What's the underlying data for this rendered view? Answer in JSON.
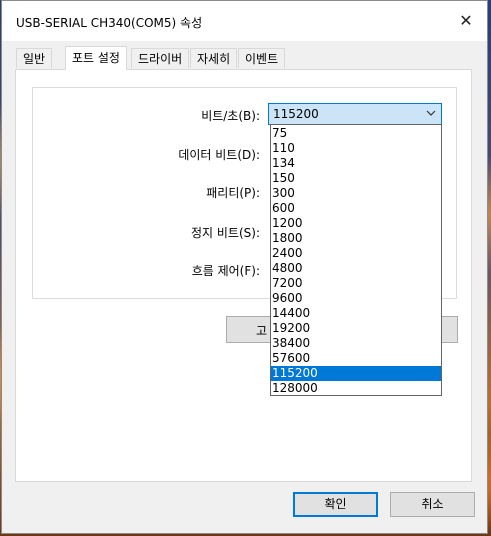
{
  "window": {
    "title": "USB-SERIAL CH340(COM5) 속성"
  },
  "tabs": [
    {
      "label": "일반",
      "active": false
    },
    {
      "label": "포트 설정",
      "active": true
    },
    {
      "label": "드라이버",
      "active": false
    },
    {
      "label": "자세히",
      "active": false
    },
    {
      "label": "이벤트",
      "active": false
    }
  ],
  "port_settings": {
    "baud_label": "비트/초(B):",
    "data_bits_label": "데이터 비트(D):",
    "parity_label": "패리티(P):",
    "stop_bits_label": "정지 비트(S):",
    "flow_control_label": "흐름 제어(F):",
    "baud_value": "115200",
    "hidden_button_partial": "고"
  },
  "baud_options": [
    "75",
    "110",
    "134",
    "150",
    "300",
    "600",
    "1200",
    "1800",
    "2400",
    "4800",
    "7200",
    "9600",
    "14400",
    "19200",
    "38400",
    "57600",
    "115200",
    "128000"
  ],
  "baud_selected_index": 16,
  "buttons": {
    "ok": "확인",
    "cancel": "취소"
  },
  "colors": {
    "accent": "#0078d7",
    "combo_bg": "#cce4f7"
  }
}
